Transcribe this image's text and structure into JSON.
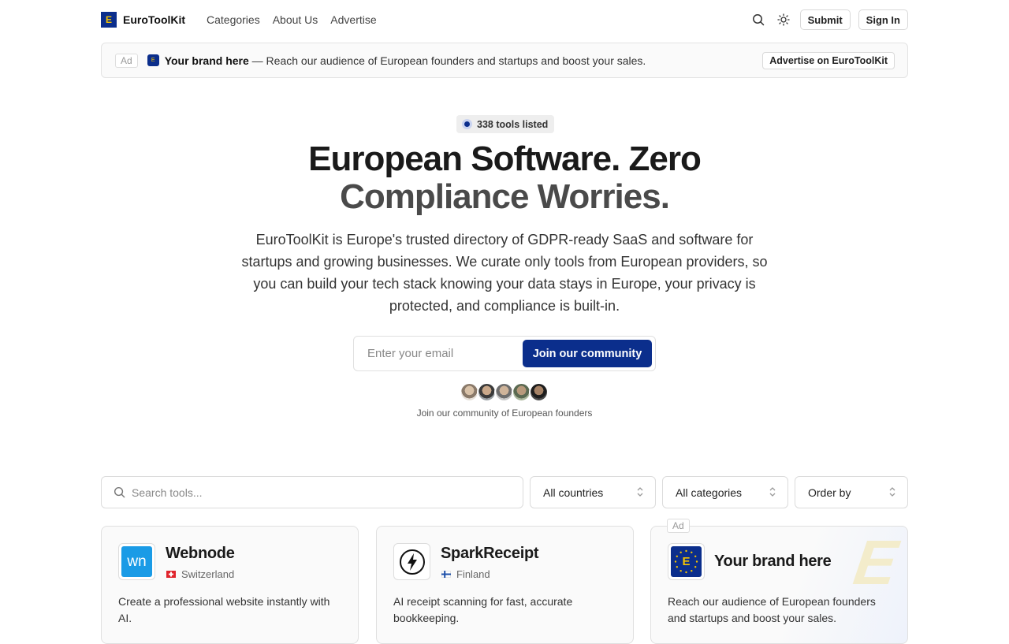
{
  "header": {
    "logo_letter": "E",
    "brand": "EuroToolKit",
    "nav": [
      "Categories",
      "About Us",
      "Advertise"
    ],
    "submit_label": "Submit",
    "signin_label": "Sign In"
  },
  "ad_banner": {
    "tag": "Ad",
    "logo_letter": "E",
    "brand": "Your brand here",
    "text": " — Reach our audience of European founders and startups and boost your sales.",
    "cta": "Advertise on EuroToolKit"
  },
  "hero": {
    "badge": "338 tools listed",
    "title_line1": "European Software. Zero",
    "title_line2": "Compliance Worries.",
    "description": "EuroToolKit is Europe's trusted directory of GDPR-ready SaaS and software for startups and growing businesses. We curate only tools from European providers, so you can build your tech stack knowing your data stays in Europe, your privacy is protected, and compliance is built-in.",
    "email_placeholder": "Enter your email",
    "join_label": "Join our community",
    "community_text": "Join our community of European founders"
  },
  "filters": {
    "search_placeholder": "Search tools...",
    "countries": "All countries",
    "categories": "All categories",
    "order": "Order by"
  },
  "cards": [
    {
      "name": "Webnode",
      "logo_text": "wn",
      "country": "Switzerland",
      "description": "Create a professional website instantly with AI."
    },
    {
      "name": "SparkReceipt",
      "logo_text": "",
      "country": "Finland",
      "description": "AI receipt scanning for fast, accurate bookkeeping."
    },
    {
      "name": "Your brand here",
      "logo_text": "E",
      "ad_tag": "Ad",
      "description": "Reach our audience of European founders and startups and boost your sales."
    }
  ],
  "colors": {
    "brand_blue": "#0b2e8c",
    "eu_gold": "#f5c400"
  }
}
